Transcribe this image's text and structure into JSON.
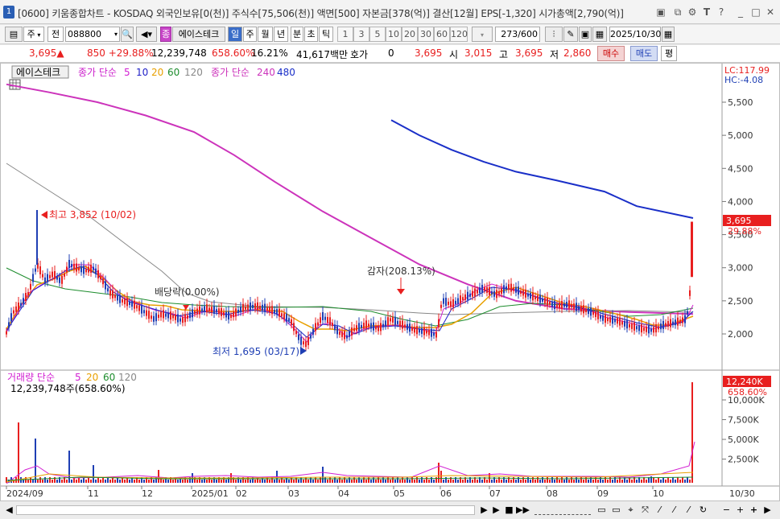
{
  "window": {
    "badge": "1",
    "title": "[0600] 키움종합차트 - KOSDAQ 외국인보유[0(천)] 주식수[75,506(천)] 액면[500] 자본금[378(억)] 결산[12월] EPS[-1,320] 시가총액[2,790(억)]",
    "icons": [
      "window-restore-icon",
      "copy-icon",
      "settings-icon",
      "font-icon",
      "help-icon",
      "minimize-icon",
      "maximize-icon",
      "close-icon"
    ]
  },
  "toolbar": {
    "mode": "주",
    "prev": "전",
    "code": "088800",
    "name": "에이스테크",
    "name_prefix": "종",
    "periods": [
      "일",
      "주",
      "월",
      "년",
      "분",
      "초",
      "틱"
    ],
    "active_period": "일",
    "intervals": [
      "1",
      "3",
      "5",
      "10",
      "20",
      "30",
      "60",
      "120"
    ],
    "count": "273",
    "count_total": "/600",
    "date": "2025/10/30"
  },
  "quote": {
    "price": "3,695",
    "arrow": "▲",
    "change": "850",
    "change_pct": "+29.88%",
    "volume": "12,239,748",
    "vol_pct": "658.60%",
    "turnover": "16.21%",
    "amount": "41,617백만",
    "hoga_label": "호가",
    "hoga": "0",
    "hoga_price": "3,695",
    "open_label": "시",
    "open": "3,015",
    "high_label": "고",
    "high": "3,695",
    "low_label": "저",
    "low": "2,860",
    "buy": "매수",
    "sell": "매도",
    "avg": "평"
  },
  "legend_price": {
    "stock": "에이스테크",
    "ma_label": "종가 단순",
    "ma": [
      "5",
      "10",
      "20",
      "60",
      "120"
    ],
    "ma2_label": "종가 단순",
    "ma2": [
      "240",
      "480"
    ]
  },
  "legend_volume": {
    "label": "거래량 단순",
    "ma": [
      "5",
      "20",
      "60",
      "120"
    ],
    "value": "12,239,748주(658.60%)"
  },
  "annotations": {
    "high": "최고 3,852 (10/02)",
    "low": "최저 1,695 (03/17)",
    "dividend": "배당락(0.00%)",
    "reduction": "감자(208.13%)"
  },
  "price_axis": {
    "lc": "LC:117.99",
    "hc": "HC:-4.08",
    "ticks": [
      "5,500",
      "5,000",
      "4,500",
      "4,000",
      "3,500",
      "3,000",
      "2,500",
      "2,000"
    ],
    "current": "3,695",
    "current_pct": "29.88%"
  },
  "volume_axis": {
    "ticks": [
      "10,000K",
      "7,500K",
      "5,000K",
      "2,500K"
    ],
    "current": "12,240K",
    "current_pct": "658.60%"
  },
  "x_axis": {
    "labels": [
      "2024/09",
      "11",
      "12",
      "2025/01",
      "02",
      "03",
      "04",
      "05",
      "06",
      "07",
      "08",
      "09",
      "10"
    ],
    "end_label": "10/30"
  },
  "colors": {
    "up": "#e81f1f",
    "down": "#1f3fb4",
    "ma5": "#d21fd2",
    "ma10": "#2020c8",
    "ma20": "#e8a000",
    "ma60": "#1c8c2c",
    "ma120": "#888888",
    "ma240": "#cc33bb",
    "ma480": "#1a2fc8"
  },
  "chart_data": {
    "type": "line",
    "ylim": [
      1600,
      5900
    ],
    "series": [
      {
        "name": "종가 단순 240",
        "values": [
          5770,
          5650,
          5500,
          5300,
          5050,
          4700,
          4300,
          3850,
          3450,
          3050,
          2750,
          2500,
          2380,
          2330,
          2300
        ]
      },
      {
        "name": "종가 단순 480",
        "values": [
          5230,
          5000,
          4780,
          4600,
          4450,
          4320,
          4150,
          3930,
          3750
        ]
      }
    ]
  }
}
